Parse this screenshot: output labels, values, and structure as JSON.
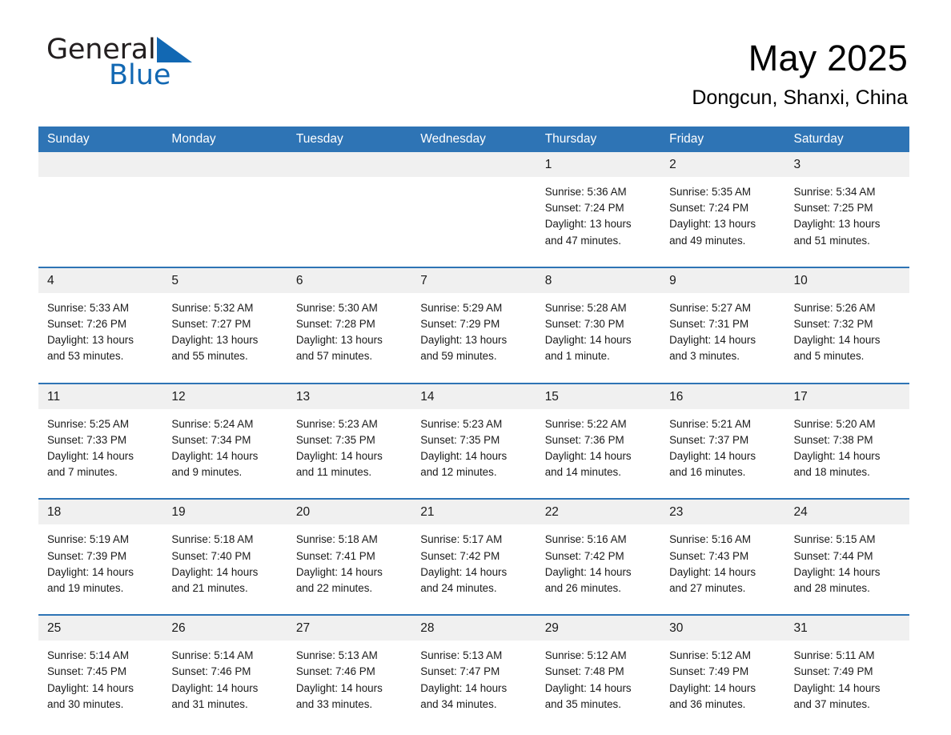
{
  "logo": {
    "word_general": "General",
    "word_blue": "Blue",
    "triangle_color": "#1268b3"
  },
  "header": {
    "month_title": "May 2025",
    "location": "Dongcun, Shanxi, China"
  },
  "theme": {
    "header_blue": "#2e74b5",
    "day_band_gray": "#f0f0f0",
    "text_black": "#1a1a1a"
  },
  "calendar": {
    "weekday_headers": [
      "Sunday",
      "Monday",
      "Tuesday",
      "Wednesday",
      "Thursday",
      "Friday",
      "Saturday"
    ],
    "weeks": [
      [
        {
          "day": "",
          "sunrise": "",
          "sunset": "",
          "daylight_line1": "",
          "daylight_line2": "",
          "empty": true
        },
        {
          "day": "",
          "sunrise": "",
          "sunset": "",
          "daylight_line1": "",
          "daylight_line2": "",
          "empty": true
        },
        {
          "day": "",
          "sunrise": "",
          "sunset": "",
          "daylight_line1": "",
          "daylight_line2": "",
          "empty": true
        },
        {
          "day": "",
          "sunrise": "",
          "sunset": "",
          "daylight_line1": "",
          "daylight_line2": "",
          "empty": true
        },
        {
          "day": "1",
          "sunrise": "Sunrise: 5:36 AM",
          "sunset": "Sunset: 7:24 PM",
          "daylight_line1": "Daylight: 13 hours",
          "daylight_line2": "and 47 minutes."
        },
        {
          "day": "2",
          "sunrise": "Sunrise: 5:35 AM",
          "sunset": "Sunset: 7:24 PM",
          "daylight_line1": "Daylight: 13 hours",
          "daylight_line2": "and 49 minutes."
        },
        {
          "day": "3",
          "sunrise": "Sunrise: 5:34 AM",
          "sunset": "Sunset: 7:25 PM",
          "daylight_line1": "Daylight: 13 hours",
          "daylight_line2": "and 51 minutes."
        }
      ],
      [
        {
          "day": "4",
          "sunrise": "Sunrise: 5:33 AM",
          "sunset": "Sunset: 7:26 PM",
          "daylight_line1": "Daylight: 13 hours",
          "daylight_line2": "and 53 minutes."
        },
        {
          "day": "5",
          "sunrise": "Sunrise: 5:32 AM",
          "sunset": "Sunset: 7:27 PM",
          "daylight_line1": "Daylight: 13 hours",
          "daylight_line2": "and 55 minutes."
        },
        {
          "day": "6",
          "sunrise": "Sunrise: 5:30 AM",
          "sunset": "Sunset: 7:28 PM",
          "daylight_line1": "Daylight: 13 hours",
          "daylight_line2": "and 57 minutes."
        },
        {
          "day": "7",
          "sunrise": "Sunrise: 5:29 AM",
          "sunset": "Sunset: 7:29 PM",
          "daylight_line1": "Daylight: 13 hours",
          "daylight_line2": "and 59 minutes."
        },
        {
          "day": "8",
          "sunrise": "Sunrise: 5:28 AM",
          "sunset": "Sunset: 7:30 PM",
          "daylight_line1": "Daylight: 14 hours",
          "daylight_line2": "and 1 minute."
        },
        {
          "day": "9",
          "sunrise": "Sunrise: 5:27 AM",
          "sunset": "Sunset: 7:31 PM",
          "daylight_line1": "Daylight: 14 hours",
          "daylight_line2": "and 3 minutes."
        },
        {
          "day": "10",
          "sunrise": "Sunrise: 5:26 AM",
          "sunset": "Sunset: 7:32 PM",
          "daylight_line1": "Daylight: 14 hours",
          "daylight_line2": "and 5 minutes."
        }
      ],
      [
        {
          "day": "11",
          "sunrise": "Sunrise: 5:25 AM",
          "sunset": "Sunset: 7:33 PM",
          "daylight_line1": "Daylight: 14 hours",
          "daylight_line2": "and 7 minutes."
        },
        {
          "day": "12",
          "sunrise": "Sunrise: 5:24 AM",
          "sunset": "Sunset: 7:34 PM",
          "daylight_line1": "Daylight: 14 hours",
          "daylight_line2": "and 9 minutes."
        },
        {
          "day": "13",
          "sunrise": "Sunrise: 5:23 AM",
          "sunset": "Sunset: 7:35 PM",
          "daylight_line1": "Daylight: 14 hours",
          "daylight_line2": "and 11 minutes."
        },
        {
          "day": "14",
          "sunrise": "Sunrise: 5:23 AM",
          "sunset": "Sunset: 7:35 PM",
          "daylight_line1": "Daylight: 14 hours",
          "daylight_line2": "and 12 minutes."
        },
        {
          "day": "15",
          "sunrise": "Sunrise: 5:22 AM",
          "sunset": "Sunset: 7:36 PM",
          "daylight_line1": "Daylight: 14 hours",
          "daylight_line2": "and 14 minutes."
        },
        {
          "day": "16",
          "sunrise": "Sunrise: 5:21 AM",
          "sunset": "Sunset: 7:37 PM",
          "daylight_line1": "Daylight: 14 hours",
          "daylight_line2": "and 16 minutes."
        },
        {
          "day": "17",
          "sunrise": "Sunrise: 5:20 AM",
          "sunset": "Sunset: 7:38 PM",
          "daylight_line1": "Daylight: 14 hours",
          "daylight_line2": "and 18 minutes."
        }
      ],
      [
        {
          "day": "18",
          "sunrise": "Sunrise: 5:19 AM",
          "sunset": "Sunset: 7:39 PM",
          "daylight_line1": "Daylight: 14 hours",
          "daylight_line2": "and 19 minutes."
        },
        {
          "day": "19",
          "sunrise": "Sunrise: 5:18 AM",
          "sunset": "Sunset: 7:40 PM",
          "daylight_line1": "Daylight: 14 hours",
          "daylight_line2": "and 21 minutes."
        },
        {
          "day": "20",
          "sunrise": "Sunrise: 5:18 AM",
          "sunset": "Sunset: 7:41 PM",
          "daylight_line1": "Daylight: 14 hours",
          "daylight_line2": "and 22 minutes."
        },
        {
          "day": "21",
          "sunrise": "Sunrise: 5:17 AM",
          "sunset": "Sunset: 7:42 PM",
          "daylight_line1": "Daylight: 14 hours",
          "daylight_line2": "and 24 minutes."
        },
        {
          "day": "22",
          "sunrise": "Sunrise: 5:16 AM",
          "sunset": "Sunset: 7:42 PM",
          "daylight_line1": "Daylight: 14 hours",
          "daylight_line2": "and 26 minutes."
        },
        {
          "day": "23",
          "sunrise": "Sunrise: 5:16 AM",
          "sunset": "Sunset: 7:43 PM",
          "daylight_line1": "Daylight: 14 hours",
          "daylight_line2": "and 27 minutes."
        },
        {
          "day": "24",
          "sunrise": "Sunrise: 5:15 AM",
          "sunset": "Sunset: 7:44 PM",
          "daylight_line1": "Daylight: 14 hours",
          "daylight_line2": "and 28 minutes."
        }
      ],
      [
        {
          "day": "25",
          "sunrise": "Sunrise: 5:14 AM",
          "sunset": "Sunset: 7:45 PM",
          "daylight_line1": "Daylight: 14 hours",
          "daylight_line2": "and 30 minutes."
        },
        {
          "day": "26",
          "sunrise": "Sunrise: 5:14 AM",
          "sunset": "Sunset: 7:46 PM",
          "daylight_line1": "Daylight: 14 hours",
          "daylight_line2": "and 31 minutes."
        },
        {
          "day": "27",
          "sunrise": "Sunrise: 5:13 AM",
          "sunset": "Sunset: 7:46 PM",
          "daylight_line1": "Daylight: 14 hours",
          "daylight_line2": "and 33 minutes."
        },
        {
          "day": "28",
          "sunrise": "Sunrise: 5:13 AM",
          "sunset": "Sunset: 7:47 PM",
          "daylight_line1": "Daylight: 14 hours",
          "daylight_line2": "and 34 minutes."
        },
        {
          "day": "29",
          "sunrise": "Sunrise: 5:12 AM",
          "sunset": "Sunset: 7:48 PM",
          "daylight_line1": "Daylight: 14 hours",
          "daylight_line2": "and 35 minutes."
        },
        {
          "day": "30",
          "sunrise": "Sunrise: 5:12 AM",
          "sunset": "Sunset: 7:49 PM",
          "daylight_line1": "Daylight: 14 hours",
          "daylight_line2": "and 36 minutes."
        },
        {
          "day": "31",
          "sunrise": "Sunrise: 5:11 AM",
          "sunset": "Sunset: 7:49 PM",
          "daylight_line1": "Daylight: 14 hours",
          "daylight_line2": "and 37 minutes."
        }
      ]
    ]
  }
}
